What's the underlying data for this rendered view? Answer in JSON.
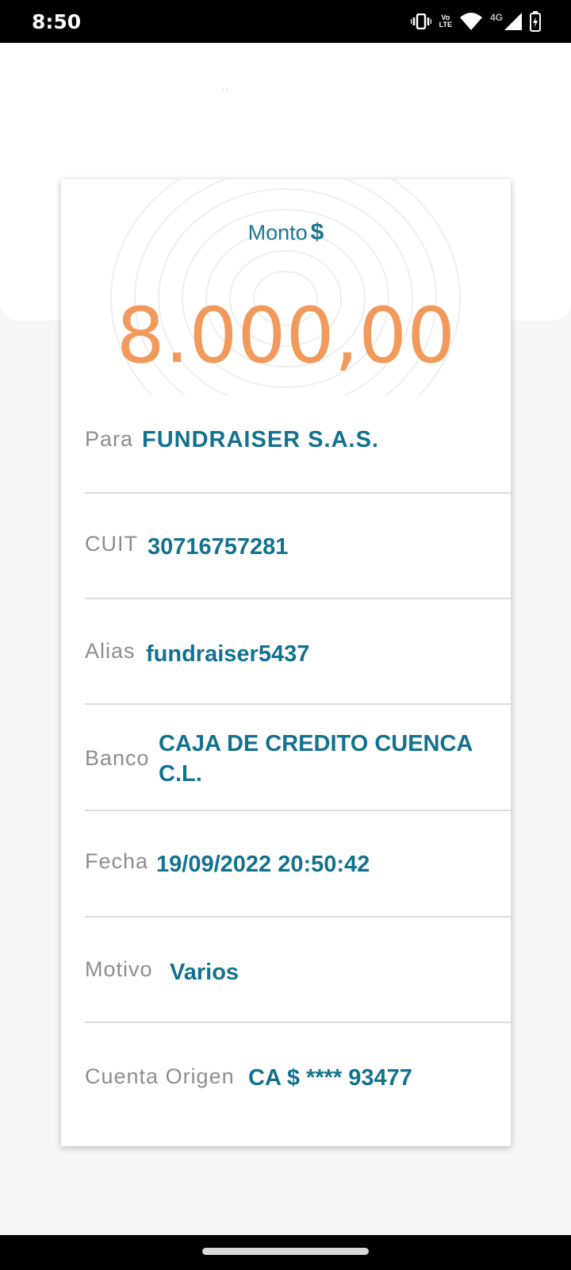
{
  "status_bar": {
    "time": "8:50",
    "volte_top": "Vo",
    "volte_bottom": "LTE",
    "network": "4G",
    "icons": [
      "vibrate-icon",
      "volte-icon",
      "wifi-icon",
      "signal-icon",
      "battery-charging-icon"
    ]
  },
  "card": {
    "monto_label": "Monto",
    "currency_symbol": "$",
    "amount": "8.000,00",
    "rows": [
      {
        "label": "Para",
        "value": "FUNDRAISER S.A.S."
      },
      {
        "label": "CUIT",
        "value": "30716757281"
      },
      {
        "label": "Alias",
        "value": "fundraiser5437"
      },
      {
        "label": "Banco",
        "value": "CAJA DE CREDITO CUENCA C.L."
      },
      {
        "label": "Fecha",
        "value": "19/09/2022 20:50:42"
      },
      {
        "label": "Motivo",
        "value": "Varios"
      },
      {
        "label": "Cuenta Origen",
        "value": "CA $ **** 93477"
      }
    ]
  },
  "colors": {
    "accent_teal": "#13728f",
    "amount_orange": "#f29a5c",
    "label_gray": "#8e8e8e"
  }
}
